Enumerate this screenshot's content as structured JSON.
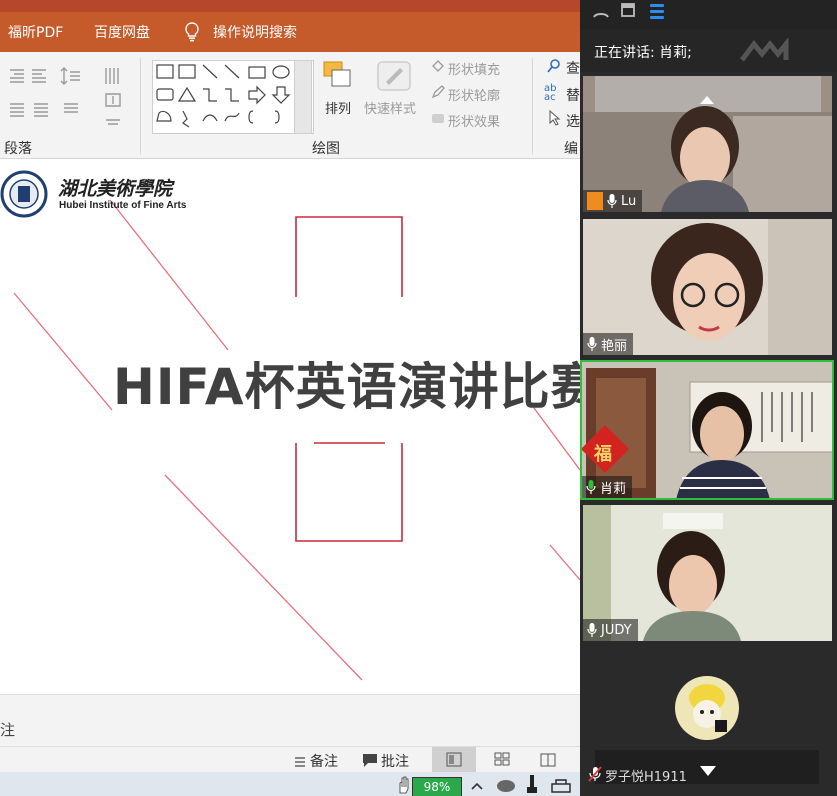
{
  "ppt": {
    "tabs": [
      "福昕PDF",
      "百度网盘",
      "操作说明搜索"
    ],
    "groups": {
      "paragraph": "段落",
      "drawing": "绘图",
      "edit": "编"
    },
    "drawing": {
      "arrange": "排列",
      "quick_styles": "快速样式",
      "shape_fill": "形状填充",
      "shape_outline": "形状轮廓",
      "shape_effects": "形状效果"
    },
    "edit": {
      "find": "查",
      "replace": "替",
      "select": "选"
    },
    "slide": {
      "logo_cn": "湖北美術學院",
      "logo_en": "Hubei Institute of Fine Arts",
      "title": "HIFA杯英语演讲比赛"
    },
    "notes_placeholder": "注",
    "status": {
      "notes": "备注",
      "comments": "批注"
    },
    "taskbar": {
      "battery": "98%"
    }
  },
  "meeting": {
    "speaking_label": "正在讲话: 肖莉;",
    "participants": [
      {
        "name": "Lu"
      },
      {
        "name": "艳丽"
      },
      {
        "name": "肖莉"
      },
      {
        "name": "JUDY"
      },
      {
        "name": "罗子悦H1911"
      }
    ]
  },
  "colors": {
    "accent_red": "#c55a2b",
    "ribbon_bg": "#f3f3f3",
    "meeting_bg": "#2a2a2a",
    "active_speaker_border": "#2fbf3b",
    "blue_icon": "#2e8cf0"
  }
}
